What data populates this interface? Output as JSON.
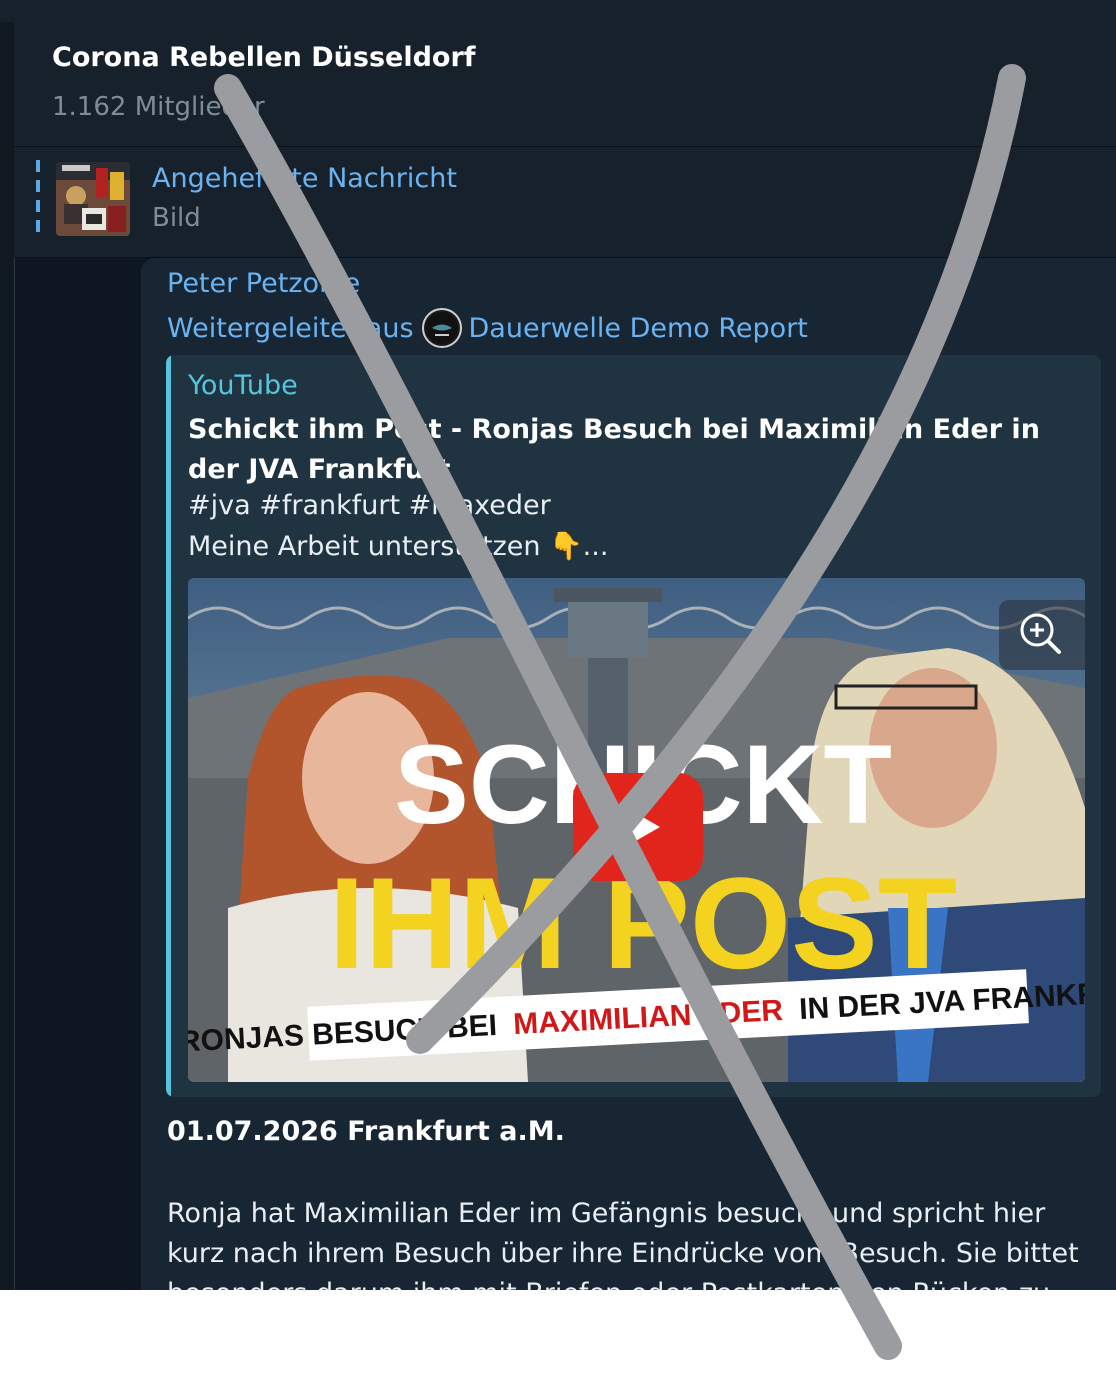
{
  "header": {
    "group_name": "Corona Rebellen Düsseldorf",
    "member_count": "1.162 Mitglieder"
  },
  "pinned": {
    "title": "Angeheftete Nachricht",
    "subtitle": "Bild"
  },
  "message": {
    "sender": "Peter Petzolde",
    "forwarded_prefix": "Weitergeleitet aus",
    "forwarded_channel": "Dauerwelle Demo Report",
    "preview": {
      "site": "YouTube",
      "title": "Schickt ihm Post - Ronjas Besuch bei Maximilian Eder in der JVA Frankfurt",
      "tags": "#jva #frankfurt #maxeder",
      "support_line": "Meine Arbeit unterstützen 👇...",
      "thumbnail_text": {
        "line1": "SCHICKT",
        "line2": "IHM POST",
        "banner_prefix": "RONJAS BESUCH BEI",
        "banner_highlight": "MAXIMILIAN EDER",
        "banner_suffix": "IN DER JVA FRANKFURT"
      }
    },
    "date_line": "01.07.2026 Frankfurt a.M.",
    "body": "Ronja hat Maximilian Eder im Gefängnis besucht und spricht hier kurz nach ihrem Besuch über ihre Eindrücke vom Besuch. Sie bittet besonders darum ihm mit Briefen oder Postkarten den Rücken zu"
  },
  "colors": {
    "background": "#0e1621",
    "panel": "#17212b",
    "bubble": "#182533",
    "link": "#6ab3f3",
    "preview_accent": "#57c4dd",
    "x_mark": "#9a9ca0"
  },
  "icons": [
    "thumbtack-image",
    "channel-avatar",
    "zoom-in-icon",
    "play-icon"
  ]
}
